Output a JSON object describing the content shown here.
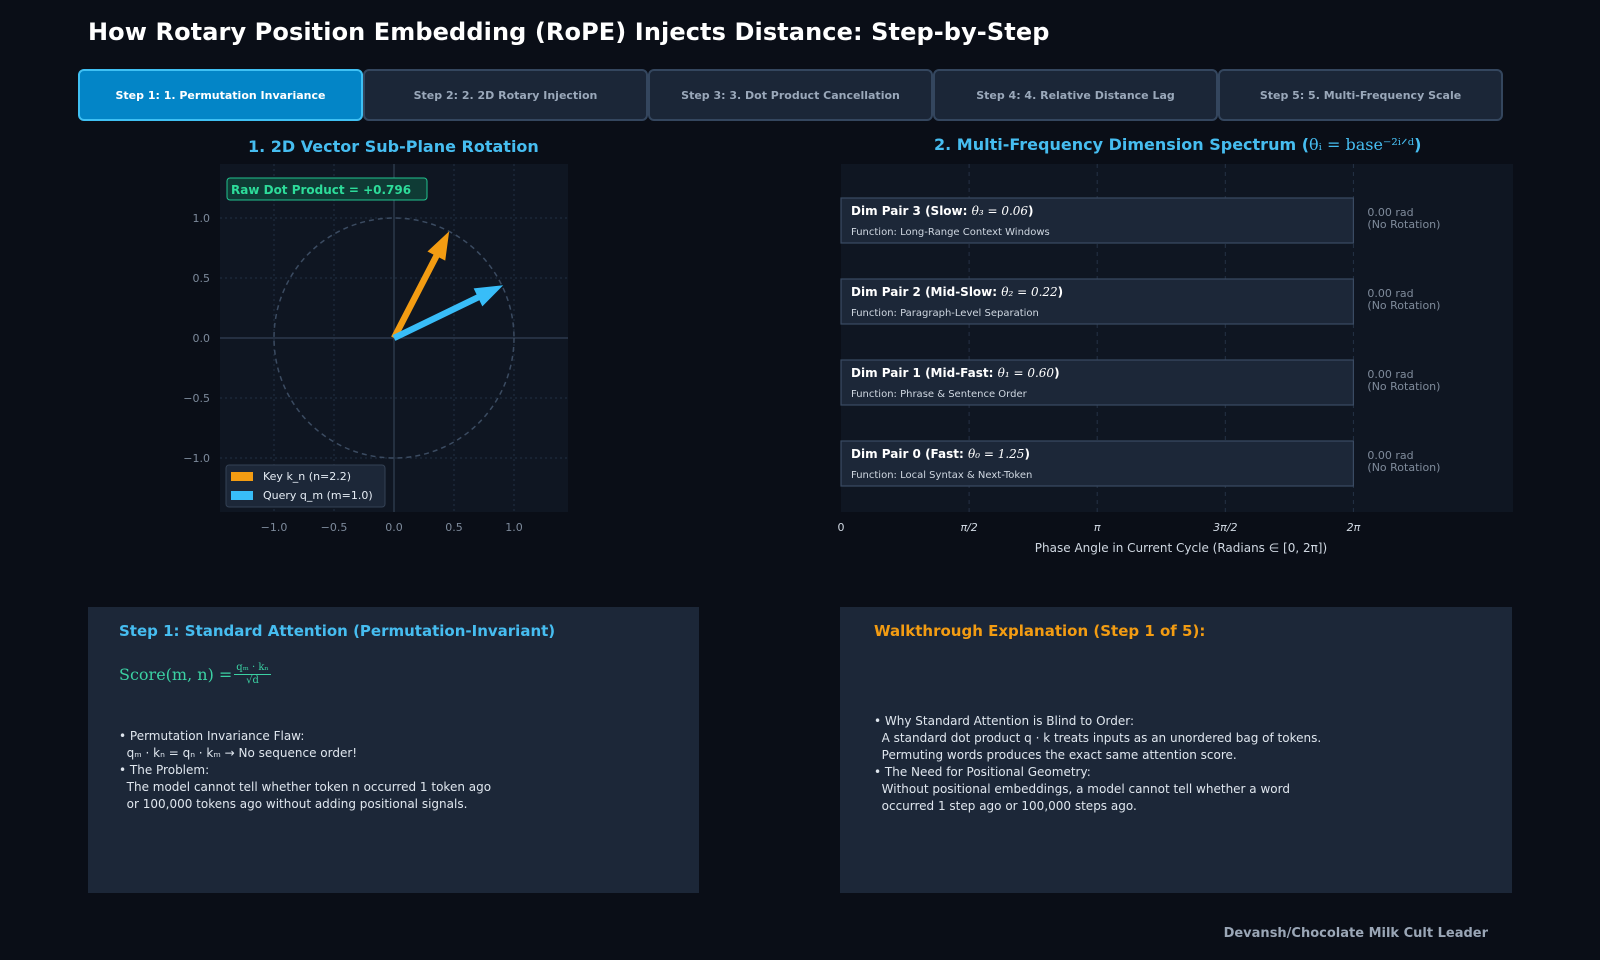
{
  "title": "How Rotary Position Embedding (RoPE) Injects Distance: Step-by-Step",
  "tabs": [
    {
      "label": "Step 1: 1. Permutation Invariance",
      "active": true
    },
    {
      "label": "Step 2: 2. 2D Rotary Injection",
      "active": false
    },
    {
      "label": "Step 3: 3. Dot Product Cancellation",
      "active": false
    },
    {
      "label": "Step 4: 4. Relative Distance Lag",
      "active": false
    },
    {
      "label": "Step 5: 5. Multi-Frequency Scale",
      "active": false
    }
  ],
  "left_panel": {
    "title": "1. 2D Vector Sub-Plane Rotation"
  },
  "right_panel": {
    "title_prefix": "2. Multi-Frequency Dimension Spectrum (",
    "title_math": "θᵢ = base⁻²ⁱᐟᵈ",
    "title_suffix": ")"
  },
  "chart_data": [
    {
      "type": "scatter",
      "title": "1. 2D Vector Sub-Plane Rotation",
      "annotation": "Raw Dot Product = +0.796",
      "xlim": [
        -1.45,
        1.45
      ],
      "ylim": [
        -1.45,
        1.45
      ],
      "xticks": [
        "−1.0",
        "−0.5",
        "0.0",
        "0.5",
        "1.0"
      ],
      "yticks": [
        "1.0",
        "0.5",
        "0.0",
        "−0.5",
        "−1.0"
      ],
      "tick_values": [
        -1.0,
        -0.5,
        0.0,
        0.5,
        1.0
      ],
      "unit_circle": true,
      "grid": true,
      "legend_position": "bottom-left",
      "series": [
        {
          "name": "Key k_n (n=2.2)",
          "color": "#f39c12",
          "vector": [
            0.46,
            0.89
          ]
        },
        {
          "name": "Query q_m (m=1.0)",
          "color": "#38bdf8",
          "vector": [
            0.91,
            0.44
          ]
        }
      ]
    },
    {
      "type": "bar",
      "title": "2. Multi-Frequency Dimension Spectrum",
      "xlabel": "Phase Angle in Current Cycle (Radians ∈ [0, 2π])",
      "xlim": [
        0,
        6.2832
      ],
      "xticks": [
        "0",
        "π/2",
        "π",
        "3π/2",
        "2π"
      ],
      "grid": true,
      "categories": [
        {
          "name": "Dim Pair 3 (Slow: ",
          "theta": "θ₃ = 0.06",
          "function": "Function: Long-Range Context Windows",
          "value": 6.2832,
          "phase": "0.00 rad",
          "note": "(No Rotation)"
        },
        {
          "name": "Dim Pair 2 (Mid-Slow: ",
          "theta": "θ₂ = 0.22",
          "function": "Function: Paragraph-Level Separation",
          "value": 6.2832,
          "phase": "0.00 rad",
          "note": "(No Rotation)"
        },
        {
          "name": "Dim Pair 1 (Mid-Fast: ",
          "theta": "θ₁ = 0.60",
          "function": "Function: Phrase & Sentence Order",
          "value": 6.2832,
          "phase": "0.00 rad",
          "note": "(No Rotation)"
        },
        {
          "name": "Dim Pair 0 (Fast: ",
          "theta": "θ₀ = 1.25",
          "function": "Function: Local Syntax & Next-Token",
          "value": 6.2832,
          "phase": "0.00 rad",
          "note": "(No Rotation)"
        }
      ]
    }
  ],
  "step_box": {
    "title": "Step 1: Standard Attention (Permutation-Invariant)",
    "formula_lhs": "Score(m, n) = ",
    "formula_num": "qₘ · kₙ",
    "formula_den": "√d",
    "lines": [
      "• Permutation Invariance Flaw:",
      "  qₘ · kₙ = qₙ · kₘ → No sequence order!",
      "",
      "• The Problem:",
      "  The model cannot tell whether token n occurred 1 token ago",
      "  or 100,000 tokens ago without adding positional signals."
    ]
  },
  "explain_box": {
    "title": "Walkthrough Explanation (Step 1 of 5):",
    "lines": [
      "• Why Standard Attention is Blind to Order:",
      "  A standard dot product q · k treats inputs as an unordered bag of tokens.",
      "  Permuting words produces the exact same attention score.",
      "",
      "• The Need for Positional Geometry:",
      "  Without positional embeddings, a model cannot tell whether a word",
      "  occurred 1 step ago or 100,000 steps ago."
    ]
  },
  "footer": "Devansh/Chocolate Milk Cult Leader",
  "colors": {
    "accent": "#46bdf0",
    "orange": "#f39c12",
    "green": "#3bd1a3",
    "background": "#0a0e17"
  }
}
